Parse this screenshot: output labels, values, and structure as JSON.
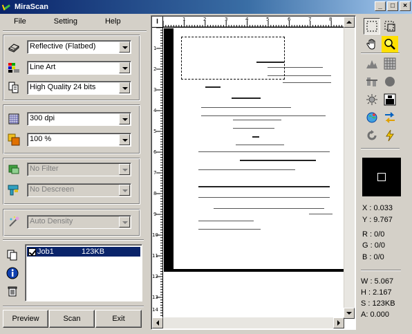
{
  "window": {
    "title": "MiraScan",
    "controls": [
      "_",
      "□",
      "×"
    ]
  },
  "menu": {
    "items": [
      "File",
      "Setting",
      "Help"
    ]
  },
  "settings": {
    "scan_type": "Reflective (Flatbed)",
    "image_type": "Line Art",
    "quality": "High Quality 24 bits",
    "resolution": "300 dpi",
    "scaling": "100 %",
    "filter": "No Filter",
    "descreen": "No Descreen",
    "density": "Auto Density"
  },
  "jobs": [
    {
      "name": "Job1",
      "size": "123KB",
      "checked": true
    }
  ],
  "buttons": {
    "preview": "Preview",
    "scan": "Scan",
    "exit": "Exit"
  },
  "ruler": {
    "corner_label": "I",
    "h_ticks": [
      "1",
      "2",
      "3",
      "4",
      "5",
      "6",
      "7",
      "8"
    ],
    "v_ticks": [
      "1",
      "2",
      "3",
      "4",
      "5",
      "6",
      "7",
      "8",
      "9",
      "10",
      "11",
      "12",
      "13",
      "14"
    ]
  },
  "coords": {
    "x": "X : 0.033",
    "y": "Y : 9.767"
  },
  "color": {
    "r": "R : 0/0",
    "g": "G : 0/0",
    "b": "B : 0/0"
  },
  "dims": {
    "w": "W : 5.067",
    "h": "H : 2.167",
    "s": "S : 123KB",
    "a": "A: 0.000"
  },
  "icons": {
    "tools": [
      "select-rect-icon",
      "auto-crop-icon",
      "hand-pan-icon",
      "zoom-icon",
      "histogram-icon",
      "curve-grid-icon",
      "color-balance-icon",
      "black-point-icon",
      "brightness-icon",
      "threshold-icon",
      "color-globe-icon",
      "swap-icon",
      "reset-icon",
      "auto-adjust-icon"
    ]
  }
}
